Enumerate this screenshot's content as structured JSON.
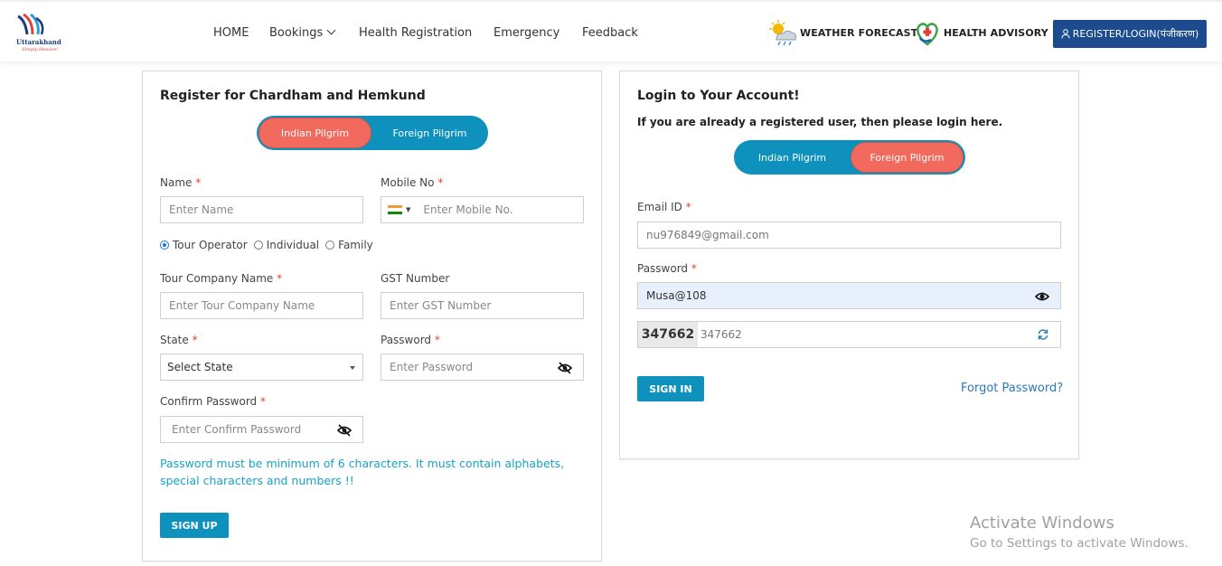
{
  "header": {
    "logo_text": "Uttarakhand",
    "logo_tagline": "Simply Heaven!",
    "nav": {
      "home": "HOME",
      "bookings": "Bookings",
      "health_registration": "Health Registration",
      "emergency": "Emergency",
      "feedback": "Feedback"
    },
    "weather_label": "WEATHER FORECAST",
    "health_advisory_label": "HEALTH ADVISORY",
    "register_login_label": "REGISTER/LOGIN(पंजीकरण)"
  },
  "register": {
    "title": "Register for Chardham and Hemkund",
    "toggle": {
      "indian": "Indian Pilgrim",
      "foreign": "Foreign Pilgrim",
      "active": "indian"
    },
    "name_label": "Name",
    "name_placeholder": "Enter Name",
    "mobile_label": "Mobile No",
    "mobile_placeholder": "Enter  Mobile No.",
    "radios": {
      "tour_operator": "Tour Operator",
      "individual": "Individual",
      "family": "Family",
      "selected": "tour_operator"
    },
    "company_label": "Tour Company Name",
    "company_placeholder": "Enter Tour Company Name",
    "gst_label": "GST Number",
    "gst_placeholder": "Enter GST Number",
    "state_label": "State",
    "state_value": "Select State",
    "password_label": "Password",
    "password_placeholder": "Enter  Password",
    "confirm_label": "Confirm Password",
    "confirm_placeholder": "Enter Confirm Password",
    "hint": "Password must be minimum of 6 characters. It must contain alphabets, special characters and numbers !!",
    "signup_label": "SIGN UP"
  },
  "login": {
    "title": "Login to Your Account!",
    "subtitle": "If you are already a registered user, then please login here.",
    "toggle": {
      "indian": "Indian Pilgrim",
      "foreign": "Foreign Pilgrim",
      "active": "foreign"
    },
    "email_label": "Email ID",
    "email_value": "nu976849@gmail.com",
    "password_label": "Password",
    "password_value": "Musa@108",
    "captcha_code": "347662",
    "captcha_value": "347662",
    "signin_label": "SIGN IN",
    "forgot_label": "Forgot Password?"
  },
  "watermark": {
    "line1": "Activate Windows",
    "line2": "Go to Settings to activate Windows."
  },
  "colors": {
    "primary": "#0e91bd",
    "active_toggle": "#f26a5e",
    "header_button": "#1d4b8f",
    "required": "#e0433a",
    "hint": "#17a2c8"
  }
}
